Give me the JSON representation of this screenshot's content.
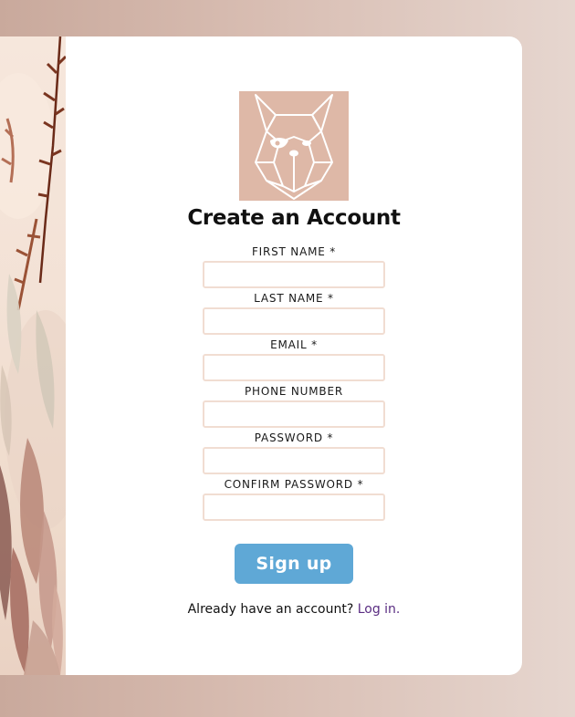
{
  "form": {
    "title": "Create an Account",
    "fields": [
      {
        "label": "FIRST NAME *",
        "value": "",
        "placeholder": ""
      },
      {
        "label": "LAST NAME *",
        "value": "",
        "placeholder": ""
      },
      {
        "label": "EMAIL *",
        "value": "",
        "placeholder": ""
      },
      {
        "label": "PHONE NUMBER",
        "value": "",
        "placeholder": ""
      },
      {
        "label": "PASSWORD *",
        "value": "",
        "placeholder": ""
      },
      {
        "label": "CONFIRM PASSWORD *",
        "value": "",
        "placeholder": ""
      }
    ],
    "submit_label": "Sign up",
    "login_prompt": "Already have an account?",
    "login_link": "Log in."
  },
  "logo": {
    "icon": "bulldog-logo-icon"
  },
  "colors": {
    "background_left": "#c9a99c",
    "background_right": "#e6d6cf",
    "card": "#ffffff",
    "logo_bg": "#deb8a7",
    "button": "#5fa8d6",
    "input_border": "#f1ddd2",
    "link": "#5a2d82"
  }
}
